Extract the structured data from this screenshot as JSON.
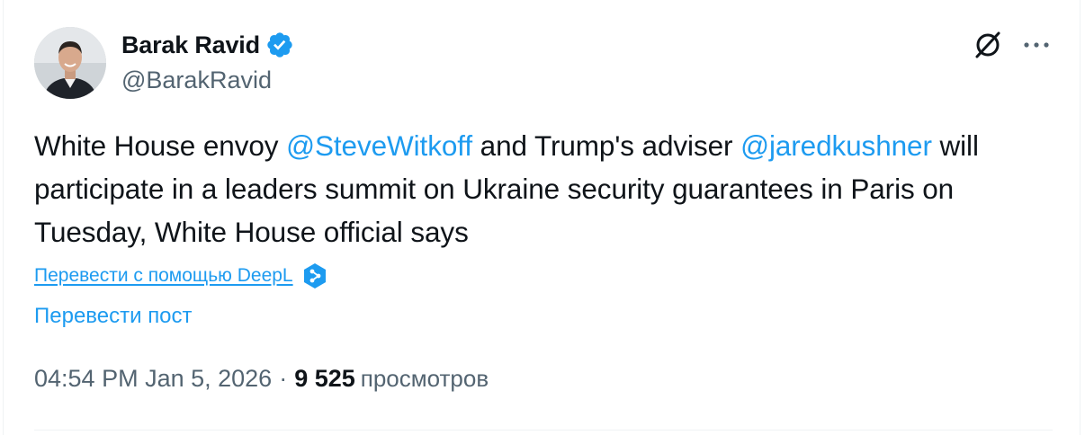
{
  "author": {
    "display_name": "Barak Ravid",
    "handle": "@BarakRavid",
    "verified": true,
    "avatar": "profile-photo"
  },
  "header_actions": {
    "grok_icon": "grok-icon",
    "more_icon": "more-horizontal-icon"
  },
  "tweet": {
    "text_parts": [
      {
        "type": "text",
        "value": "White House envoy "
      },
      {
        "type": "mention",
        "value": "@SteveWitkoff"
      },
      {
        "type": "text",
        "value": " and Trump's adviser "
      },
      {
        "type": "mention",
        "value": "@jaredkushner"
      },
      {
        "type": "text",
        "value": " will participate in a leaders summit on Ukraine security guarantees in Paris on Tuesday, White House official says"
      }
    ]
  },
  "translate": {
    "deepl_label": "Перевести с помощью DeepL",
    "deepl_icon": "deepl-icon",
    "post_label": "Перевести пост"
  },
  "meta": {
    "timestamp": "04:54 PM Jan 5, 2026",
    "separator": "·",
    "views_count": "9 525",
    "views_label": "просмотров"
  },
  "colors": {
    "accent": "#1d9bf0",
    "text_primary": "#0f1419",
    "text_secondary": "#536471",
    "border": "#eff3f4"
  }
}
